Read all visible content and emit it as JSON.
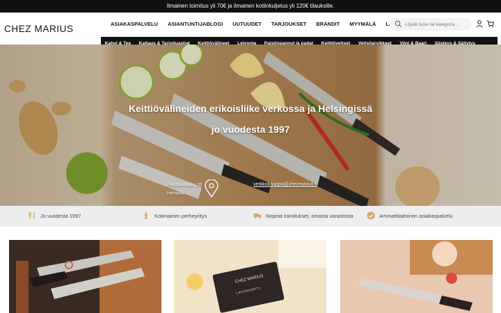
{
  "promo": {
    "text": "Ilmainen toimitus yli 70€ ja ilmainen kotiinkuljetus yli 120€ tilauksille."
  },
  "header": {
    "logo": "CHEZ MARIUS",
    "topnav": [
      "ASIAKASPALVELU",
      "ASIANTUNTIJABLOGI",
      "UUTUUDET",
      "TARJOUKSET",
      "BRÄNDIT",
      "MYYMÄLÄ",
      "LAHJAKORTTI"
    ],
    "search_placeholder": "Löydä tuote tai kategoria...",
    "icons": {
      "search": "search-icon",
      "user": "user-icon",
      "cart": "cart-icon"
    }
  },
  "categories": [
    "Kahvi & Tee",
    "Kattaus & Tarjoiluastiat",
    "Keittiövälineet",
    "Leivonta",
    "Paistinpannut ja padat",
    "Keittiöveitset",
    "Veitsitarvikkeet",
    "Viini & Baari",
    "Siisteys & Säilytys"
  ],
  "hero": {
    "title_line1": "Keittiövälineiden erikoisliike verkossa ja Helsingissä",
    "title_line2": "jo vuodesta 1997",
    "address_line1": "Fredrikinkatu 26",
    "address_line2": "Helsinki",
    "email": "verkkokauppa@chezmarius.fi"
  },
  "features": [
    {
      "icon": "cutlery-icon",
      "label": "Jo vuodesta 1997"
    },
    {
      "icon": "finland-icon",
      "label": "Kotimainen perheyritys"
    },
    {
      "icon": "truck-icon",
      "label": "Nopeat toimitukset, omasta varastosta"
    },
    {
      "icon": "check-badge-icon",
      "label": "Ammattitaitoinen asiakaspalvelu"
    }
  ],
  "giftcard": {
    "brand": "CHEZ MARIUS",
    "label": "LAHJAKORTTI"
  },
  "colors": {
    "topbar": "#111111",
    "accent": "#d4a56a",
    "feature_bg": "#eeeeee"
  }
}
